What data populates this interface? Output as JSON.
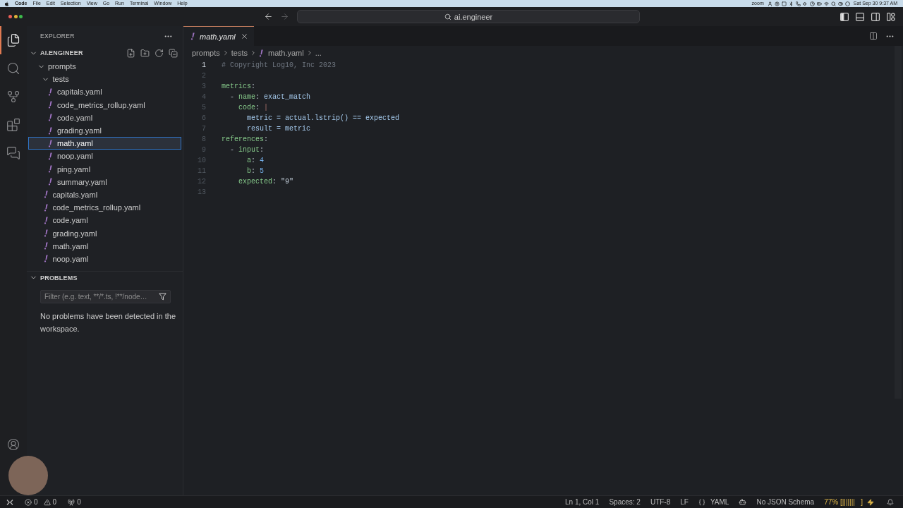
{
  "menu_bar": {
    "app": "Code",
    "menus": [
      "File",
      "Edit",
      "Selection",
      "View",
      "Go",
      "Run",
      "Terminal",
      "Window",
      "Help"
    ],
    "extra_label": "zoom",
    "clock": "Sat Sep 30 9:37 AM"
  },
  "title_bar": {
    "navigation": [
      {
        "kind": "back",
        "disabled": false
      },
      {
        "kind": "forward",
        "disabled": true
      }
    ],
    "search": "ai.engineer",
    "layout_toggles": [
      {
        "kind": "primary_sidebar",
        "on": true
      },
      {
        "kind": "panel",
        "on": false
      },
      {
        "kind": "secondary_sidebar",
        "on": false
      }
    ]
  },
  "activity_bar": {
    "items": [
      {
        "kind": "explorer",
        "selected": true
      },
      {
        "kind": "search",
        "selected": false
      },
      {
        "kind": "source_control",
        "selected": false
      },
      {
        "kind": "extensions",
        "selected": false
      },
      {
        "kind": "remote_explorer",
        "selected": false
      }
    ]
  },
  "sidebar": {
    "title": "EXPLORER",
    "workspace": {
      "label": "AI.ENGINEER",
      "expanded": true
    },
    "tree": [
      {
        "kind": "folder",
        "label": "prompts",
        "expanded": true,
        "selected": false,
        "children": [
          {
            "kind": "folder",
            "label": "tests",
            "expanded": true,
            "selected": false,
            "children": [
              {
                "kind": "yaml",
                "label": "capitals.yaml",
                "selected": false
              },
              {
                "kind": "yaml",
                "label": "code_metrics_rollup.yaml",
                "selected": false
              },
              {
                "kind": "yaml",
                "label": "code.yaml",
                "selected": false
              },
              {
                "kind": "yaml",
                "label": "grading.yaml",
                "selected": false
              },
              {
                "kind": "yaml",
                "label": "math.yaml",
                "selected": true
              },
              {
                "kind": "yaml",
                "label": "noop.yaml",
                "selected": false
              },
              {
                "kind": "yaml",
                "label": "ping.yaml",
                "selected": false
              },
              {
                "kind": "yaml",
                "label": "summary.yaml",
                "selected": false
              }
            ]
          },
          {
            "kind": "yaml",
            "label": "capitals.yaml",
            "selected": false
          },
          {
            "kind": "yaml",
            "label": "code_metrics_rollup.yaml",
            "selected": false
          },
          {
            "kind": "yaml",
            "label": "code.yaml",
            "selected": false
          },
          {
            "kind": "yaml",
            "label": "grading.yaml",
            "selected": false
          },
          {
            "kind": "yaml",
            "label": "math.yaml",
            "selected": false
          },
          {
            "kind": "yaml",
            "label": "noop.yaml",
            "selected": false
          }
        ]
      }
    ],
    "problems": {
      "title": "PROBLEMS",
      "expanded": true,
      "filter_placeholder": "Filter (e.g. text, **/*.ts, !**/node…",
      "message": "No problems have been detected in the workspace."
    }
  },
  "editor": {
    "tabs": [
      {
        "label": "math.yaml",
        "kind": "yaml",
        "selected": true,
        "preview": true
      }
    ],
    "breadcrumbs": [
      {
        "label": "prompts",
        "kind": "folder"
      },
      {
        "label": "tests",
        "kind": "folder"
      },
      {
        "label": "math.yaml",
        "kind": "yaml"
      },
      {
        "label": "...",
        "kind": "symbol"
      }
    ],
    "lines": [
      {
        "number": "1",
        "active": true,
        "tokens": [
          {
            "kind": "comment",
            "text": "# Copyright Log10, Inc 2023"
          }
        ]
      },
      {
        "number": "2",
        "active": false
      },
      {
        "number": "3",
        "active": false,
        "tokens": [
          {
            "kind": "key",
            "text": "metrics"
          },
          {
            "kind": "punct",
            "text": ":"
          }
        ]
      },
      {
        "number": "4",
        "active": false,
        "tokens": [
          {
            "kind": "punct",
            "text": "  - "
          },
          {
            "kind": "key",
            "text": "name"
          },
          {
            "kind": "punct",
            "text": ": "
          },
          {
            "kind": "value",
            "text": "exact_match"
          }
        ]
      },
      {
        "number": "5",
        "active": false,
        "tokens": [
          {
            "kind": "key",
            "text": "    code"
          },
          {
            "kind": "punct",
            "text": ": "
          },
          {
            "kind": "block",
            "text": "|"
          }
        ]
      },
      {
        "number": "6",
        "active": false,
        "tokens": [
          {
            "kind": "value",
            "text": "      metric = actual.lstrip() == expected"
          }
        ]
      },
      {
        "number": "7",
        "active": false,
        "tokens": [
          {
            "kind": "value",
            "text": "      result = metric"
          }
        ]
      },
      {
        "number": "8",
        "active": false,
        "tokens": [
          {
            "kind": "key",
            "text": "references"
          },
          {
            "kind": "punct",
            "text": ":"
          }
        ]
      },
      {
        "number": "9",
        "active": false,
        "tokens": [
          {
            "kind": "punct",
            "text": "  - "
          },
          {
            "kind": "key",
            "text": "input"
          },
          {
            "kind": "punct",
            "text": ":"
          }
        ]
      },
      {
        "number": "10",
        "active": false,
        "tokens": [
          {
            "kind": "key",
            "text": "      a"
          },
          {
            "kind": "punct",
            "text": ": "
          },
          {
            "kind": "number",
            "text": "4"
          }
        ]
      },
      {
        "number": "11",
        "active": false,
        "tokens": [
          {
            "kind": "key",
            "text": "      b"
          },
          {
            "kind": "punct",
            "text": ": "
          },
          {
            "kind": "number",
            "text": "5"
          }
        ]
      },
      {
        "number": "12",
        "active": false,
        "tokens": [
          {
            "kind": "key",
            "text": "    expected"
          },
          {
            "kind": "punct",
            "text": ": "
          },
          {
            "kind": "string",
            "text": "\"9\""
          }
        ]
      },
      {
        "number": "13",
        "active": false
      }
    ]
  },
  "status_bar": {
    "left": [
      {
        "kind": "remote"
      },
      {
        "kind": "problems",
        "errors": "0",
        "warnings": "0"
      },
      {
        "kind": "ports",
        "count": "0"
      }
    ],
    "right": [
      {
        "kind": "text",
        "text": "Ln 1, Col 1"
      },
      {
        "kind": "text",
        "text": "Spaces: 2"
      },
      {
        "kind": "text",
        "text": "UTF-8"
      },
      {
        "kind": "text",
        "text": "LF"
      },
      {
        "kind": "language",
        "text": "YAML"
      },
      {
        "kind": "copilot"
      },
      {
        "kind": "text",
        "text": "No JSON Schema"
      },
      {
        "kind": "battery",
        "text": "77% [|||||||   ]"
      },
      {
        "kind": "charging"
      },
      {
        "kind": "notifications"
      }
    ]
  },
  "overlay": {
    "kind": "webcam"
  }
}
